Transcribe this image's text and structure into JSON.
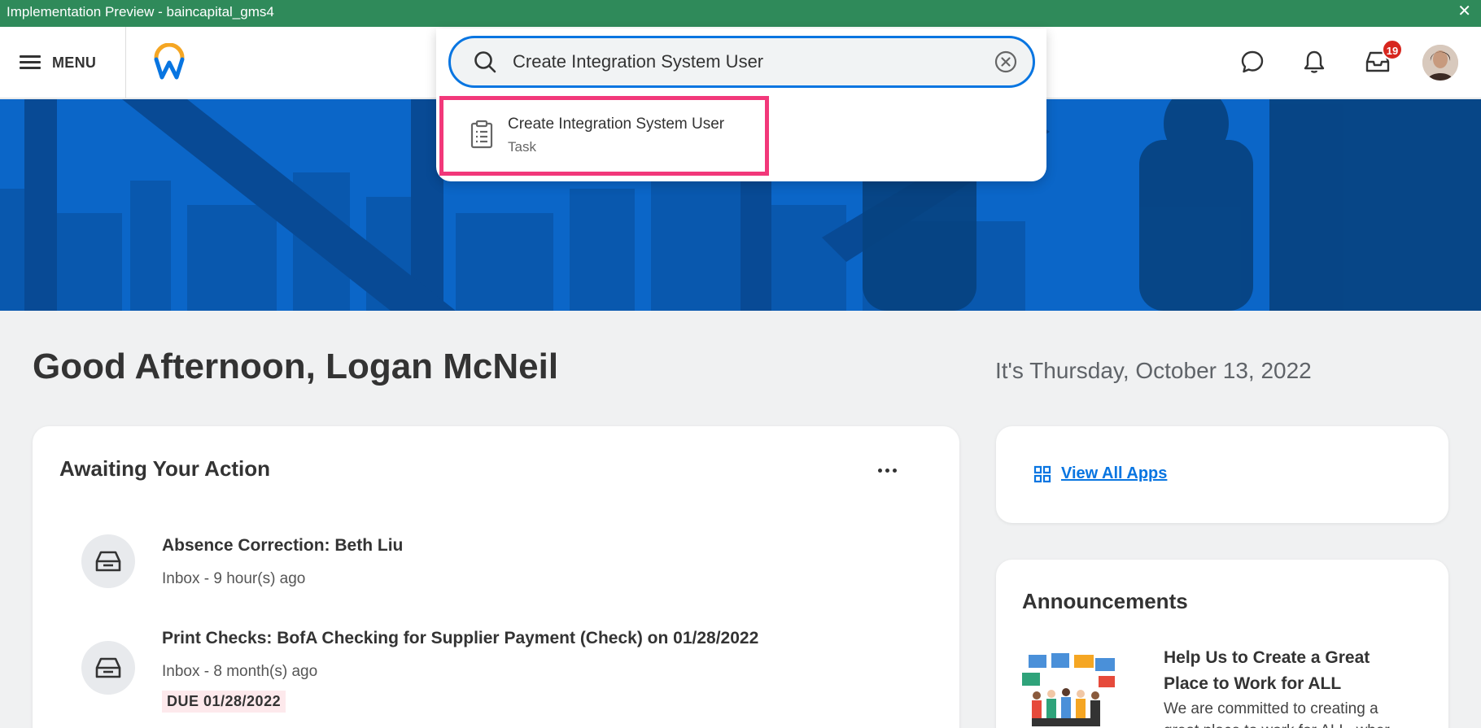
{
  "window": {
    "title": "Implementation Preview - baincapital_gms4",
    "close_glyph": "✕"
  },
  "header": {
    "menu_label": "MENU",
    "inbox_count": "19",
    "icons": [
      "chat-icon",
      "bell-icon",
      "inbox-icon"
    ]
  },
  "search": {
    "query": "Create Integration System User",
    "results": [
      {
        "title": "Create Integration System User",
        "type": "Task"
      }
    ]
  },
  "greeting": "Good Afternoon, Logan McNeil",
  "date": "It's Thursday, October 13, 2022",
  "awaiting": {
    "title": "Awaiting Your Action",
    "items": [
      {
        "title": "Absence Correction: Beth Liu",
        "subtitle": "Inbox - 9 hour(s) ago"
      },
      {
        "title": "Print Checks: BofA Checking for Supplier Payment (Check) on 01/28/2022",
        "subtitle": "Inbox - 8 month(s) ago",
        "due": "DUE 01/28/2022"
      }
    ]
  },
  "apps": {
    "link_label": "View All Apps"
  },
  "announcements": {
    "title": "Announcements",
    "item_title": "Help Us to Create a Great Place to Work for ALL",
    "item_text": "We are committed to creating a great place to work for ALL, wher"
  },
  "colors": {
    "accent": "#0875e1",
    "titlebar": "#2f8a5a",
    "highlight": "#f2387a",
    "banner": "#0a63c4",
    "badge": "#d7261e"
  }
}
